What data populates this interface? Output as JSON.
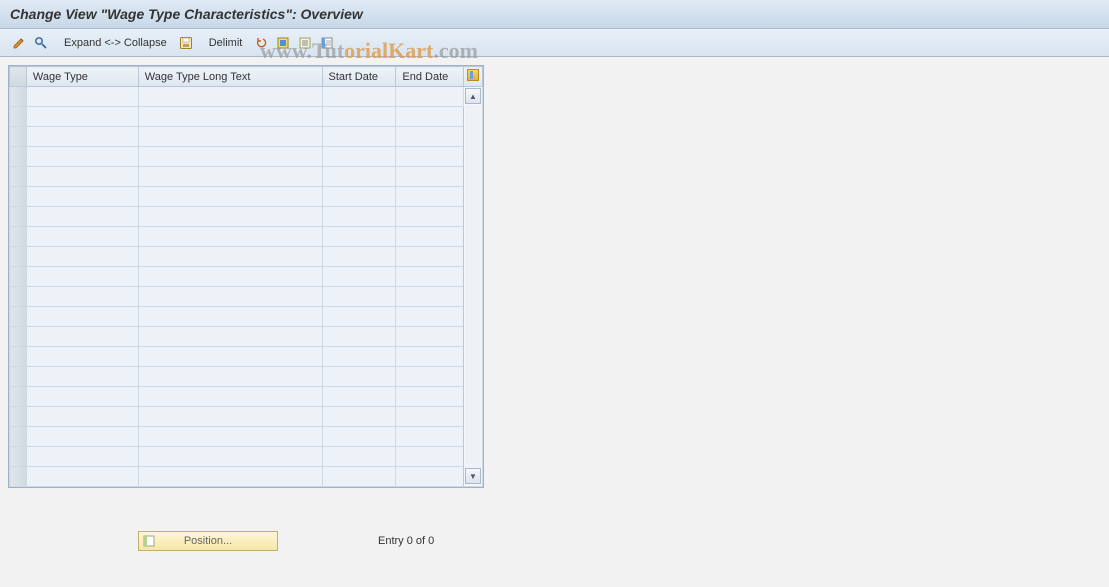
{
  "title": "Change View \"Wage Type Characteristics\": Overview",
  "toolbar": {
    "expand_collapse": "Expand <-> Collapse",
    "delimit": "Delimit"
  },
  "table": {
    "headers": {
      "wage_type": "Wage Type",
      "long_text": "Wage Type Long Text",
      "start_date": "Start Date",
      "end_date": "End Date"
    },
    "row_count": 20
  },
  "footer": {
    "position_label": "Position...",
    "entry_label": "Entry 0 of 0"
  },
  "watermark": {
    "part1": "www.Tut",
    "part2": "orialKart",
    "part3": ".com"
  }
}
